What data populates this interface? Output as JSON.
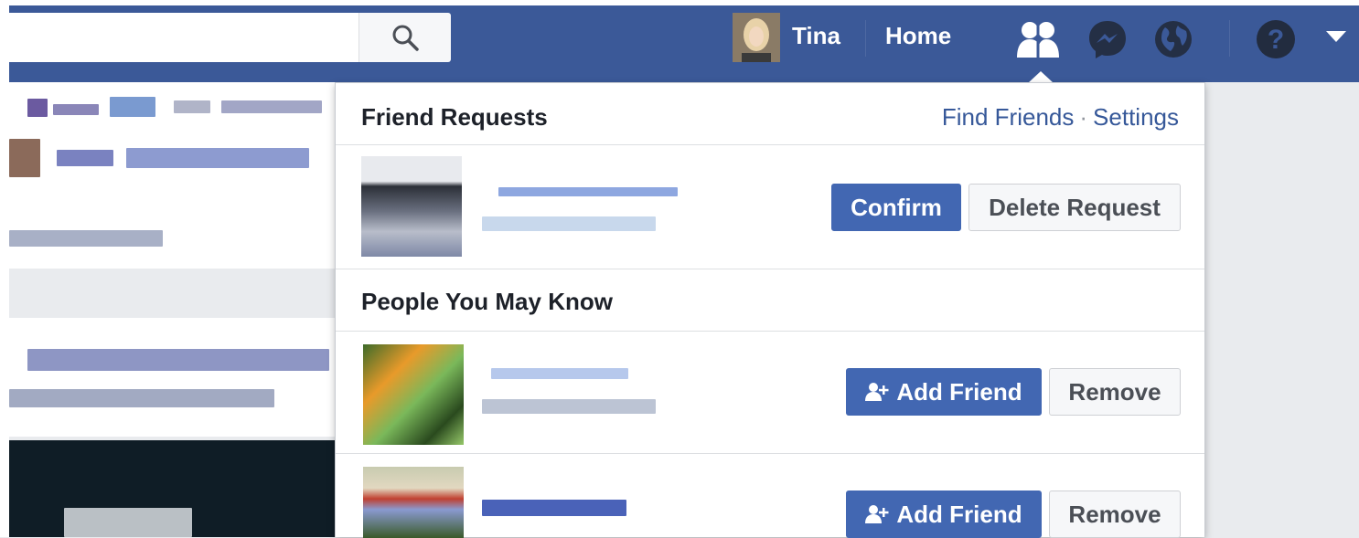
{
  "header": {
    "search_placeholder": "",
    "user_name": "Tina",
    "home_label": "Home"
  },
  "icons": {
    "search": "search-icon",
    "friends": "friend-requests-icon",
    "messages": "messenger-icon",
    "notifications": "globe-icon",
    "help": "help-icon",
    "menu": "caret-down-icon"
  },
  "colors": {
    "brand": "#3b5998",
    "primary_button": "#4267b2",
    "link": "#365899"
  },
  "dropdown": {
    "friend_requests": {
      "title": "Friend Requests",
      "find_friends": "Find Friends",
      "separator": "·",
      "settings": "Settings",
      "items": [
        {
          "confirm_label": "Confirm",
          "delete_label": "Delete Request"
        }
      ]
    },
    "people_you_may_know": {
      "title": "People You May Know",
      "items": [
        {
          "add_label": "Add Friend",
          "remove_label": "Remove"
        },
        {
          "add_label": "Add Friend",
          "remove_label": "Remove"
        }
      ]
    }
  }
}
